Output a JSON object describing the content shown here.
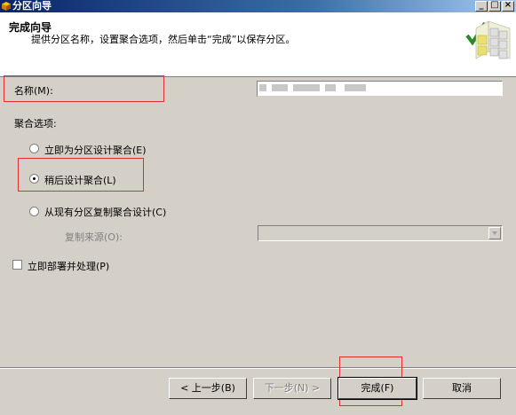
{
  "window": {
    "title": "分区向导"
  },
  "header": {
    "title": "完成向导",
    "subtitle": "提供分区名称，设置聚合选项，然后单击“完成”以保存分区。"
  },
  "name_field": {
    "label": "名称(M):",
    "value": ""
  },
  "aggregation": {
    "heading": "聚合选项:",
    "options": [
      {
        "label": "立即为分区设计聚合(E)",
        "selected": false
      },
      {
        "label": "稍后设计聚合(L)",
        "selected": true
      },
      {
        "label": "从现有分区复制聚合设计(C)",
        "selected": false
      }
    ],
    "copy_source_label": "复制来源(O):",
    "copy_source_value": ""
  },
  "deploy_checkbox": {
    "label": "立即部署并处理(P)",
    "checked": false
  },
  "buttons": {
    "back": "< 上一步(B)",
    "next": "下一步(N) >",
    "finish": "完成(F)",
    "cancel": "取消"
  },
  "colors": {
    "highlight_box": "#e03030",
    "title_bar_start": "#0a246a",
    "title_bar_end": "#a6caf0"
  }
}
